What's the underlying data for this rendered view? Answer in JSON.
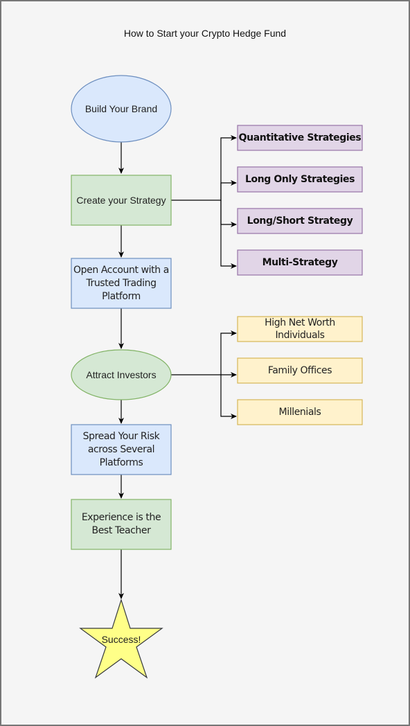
{
  "title": "How to Start your Crypto Hedge Fund",
  "colors": {
    "blue_fill": "#dae8fc",
    "blue_stroke": "#6c8ebf",
    "green_fill": "#d5e8d4",
    "green_stroke": "#82b366",
    "purple_fill": "#e1d5e7",
    "purple_stroke": "#9673a6",
    "yellow_fill": "#fff2cc",
    "yellow_stroke": "#d6b656",
    "star_fill": "#ffff88",
    "star_stroke": "#36393d"
  },
  "main_flow": [
    {
      "id": "build-brand",
      "label": "Build Your Brand",
      "shape": "ellipse"
    },
    {
      "id": "create-strategy",
      "label": "Create your Strategy",
      "shape": "rectangle"
    },
    {
      "id": "open-account",
      "label": "Open Account with a Trusted Trading Platform",
      "shape": "rectangle"
    },
    {
      "id": "attract-investors",
      "label": "Attract Investors",
      "shape": "ellipse"
    },
    {
      "id": "spread-risk",
      "label": "Spread Your Risk across Several Platforms",
      "shape": "rectangle"
    },
    {
      "id": "experience",
      "label": "Experience is the Best Teacher",
      "shape": "rectangle"
    },
    {
      "id": "success",
      "label": "Success!",
      "shape": "star"
    }
  ],
  "strategies": [
    {
      "label": "Quantitative Strategies"
    },
    {
      "label": "Long Only Strategies"
    },
    {
      "label": "Long/Short Strategy"
    },
    {
      "label": "Multi-Strategy"
    }
  ],
  "investors": [
    {
      "label": "High Net Worth Individuals"
    },
    {
      "label": "Family Offices"
    },
    {
      "label": "Millenials"
    }
  ]
}
